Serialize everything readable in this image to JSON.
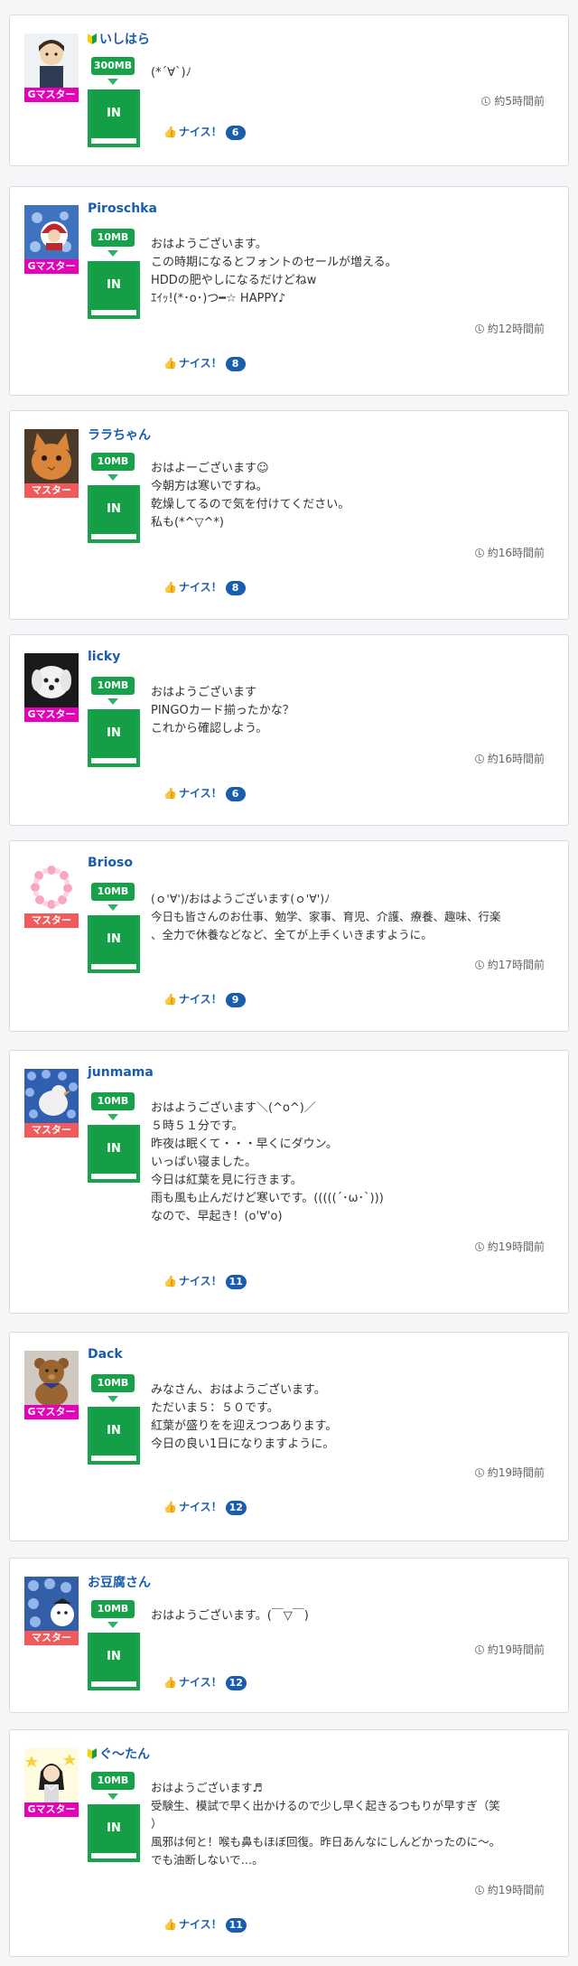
{
  "posts": [
    {
      "name": "いしはら",
      "rank": "Gマスター",
      "mb": "300MB",
      "in": "IN",
      "msg": "(*´∀`)ﾉ",
      "time": "約5時間前",
      "nice": "ナイス！",
      "count": "6"
    },
    {
      "name": "Piroschka",
      "rank": "Gマスター",
      "mb": "10MB",
      "in": "IN",
      "msg": "おはようございます。\nこの時期になるとフォントのセールが増える。\nHDDの肥やしになるだけどねw\nｴｲｯ!(*･o･)つ━☆ HAPPY♪",
      "time": "約12時間前",
      "nice": "ナイス！",
      "count": "8"
    },
    {
      "name": "ララちゃん",
      "rank": "マスター",
      "mb": "10MB",
      "in": "IN",
      "msg": "おはよーございます☺\n今朝方は寒いですね。\n乾燥してるので気を付けてください。\n私も(*^▽^*)",
      "time": "約16時間前",
      "nice": "ナイス！",
      "count": "8"
    },
    {
      "name": "licky",
      "rank": "Gマスター",
      "mb": "10MB",
      "in": "IN",
      "msg": "おはようございます\nPINGOカード揃ったかな？\nこれから確認しよう。",
      "time": "約16時間前",
      "nice": "ナイス！",
      "count": "6"
    },
    {
      "name": "Brioso",
      "rank": "マスター",
      "mb": "10MB",
      "in": "IN",
      "msg": "(ｏ'∀')/おはようございます(ｏ'∀')ﾉ\n今日も皆さんのお仕事、勉学、家事、育児、介護、療養、趣味、行楽\n、全力で休養などなど、全てが上手くいきますように。",
      "time": "約17時間前",
      "nice": "ナイス！",
      "count": "9"
    },
    {
      "name": "junmama",
      "rank": "マスター",
      "mb": "10MB",
      "in": "IN",
      "msg": "おはようございます＼(^o^)／\n５時５１分です。\n昨夜は眠くて・・・早くにダウン。\nいっぱい寝ました。\n今日は紅葉を見に行きます。\n雨も風も止んだけど寒いです。(((((´･ω･`)))\nなので、早起き！(o'∀'o)",
      "time": "約19時間前",
      "nice": "ナイス！",
      "count": "11"
    },
    {
      "name": "Dack",
      "rank": "Gマスター",
      "mb": "10MB",
      "in": "IN",
      "msg": "みなさん、おはようございます。\nただいま５：５０です。\n紅葉が盛りをを迎えつつあります。\n今日の良い1日になりますように。",
      "time": "約19時間前",
      "nice": "ナイス！",
      "count": "12"
    },
    {
      "name": "お豆腐さん",
      "rank": "マスター",
      "mb": "10MB",
      "in": "IN",
      "msg": "おはようございます。(￣▽￣)",
      "time": "約19時間前",
      "nice": "ナイス！",
      "count": "12"
    },
    {
      "name": "ぐ～たん",
      "rank": "Gマスター",
      "mb": "10MB",
      "in": "IN",
      "msg": "おはようございます♬\n受験生、模試で早く出かけるので少し早く起きるつもりが早すぎ（笑\n）\n風邪は何と！喉も鼻もほぼ回復。昨日あんなにしんどかったのに〜。\nでも油断しないで…。",
      "time": "約19時間前",
      "nice": "ナイス！",
      "count": "11"
    }
  ]
}
